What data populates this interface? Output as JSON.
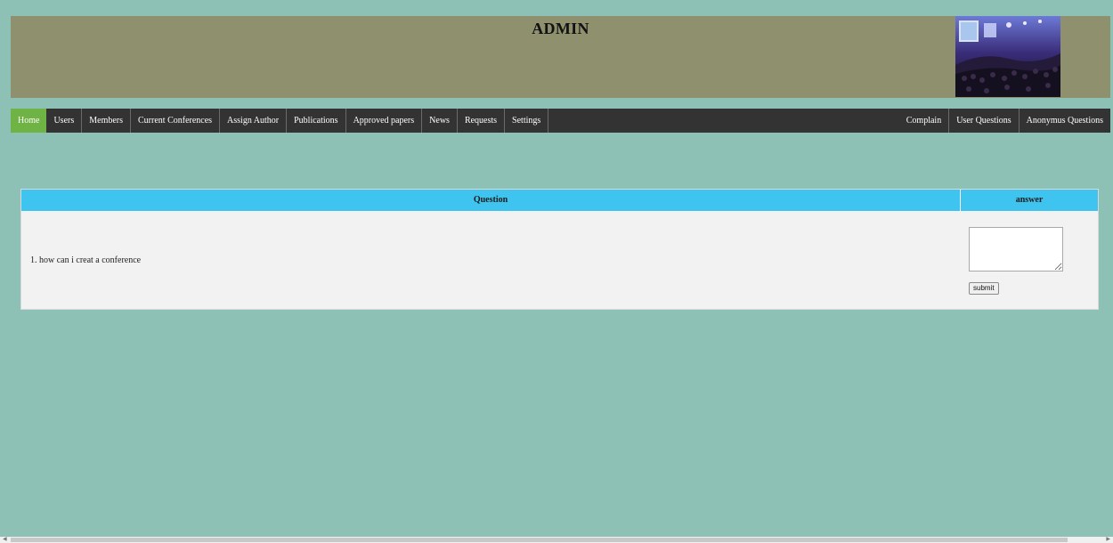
{
  "header": {
    "title": "ADMIN",
    "photo": "conference-audience-photo"
  },
  "nav": {
    "left": [
      {
        "label": "Home",
        "active": true
      },
      {
        "label": "Users"
      },
      {
        "label": "Members"
      },
      {
        "label": "Current Conferences"
      },
      {
        "label": "Assign Author"
      },
      {
        "label": "Publications"
      },
      {
        "label": "Approved papers"
      },
      {
        "label": "News"
      },
      {
        "label": "Requests"
      },
      {
        "label": "Settings"
      }
    ],
    "right": [
      {
        "label": "Complain"
      },
      {
        "label": "User Questions"
      },
      {
        "label": "Anonymus Questions"
      }
    ]
  },
  "table": {
    "headers": {
      "question": "Question",
      "answer": "answer"
    },
    "rows": [
      {
        "question": "1. how can i creat a conference",
        "answer_value": "",
        "submit_label": "submit"
      }
    ]
  },
  "colors": {
    "page_bg": "#8dc1b5",
    "header_bg": "#8f916e",
    "nav_bg": "#333333",
    "nav_active": "#6fb344",
    "table_head": "#3fc3ef",
    "table_body": "#f2f2f2"
  }
}
